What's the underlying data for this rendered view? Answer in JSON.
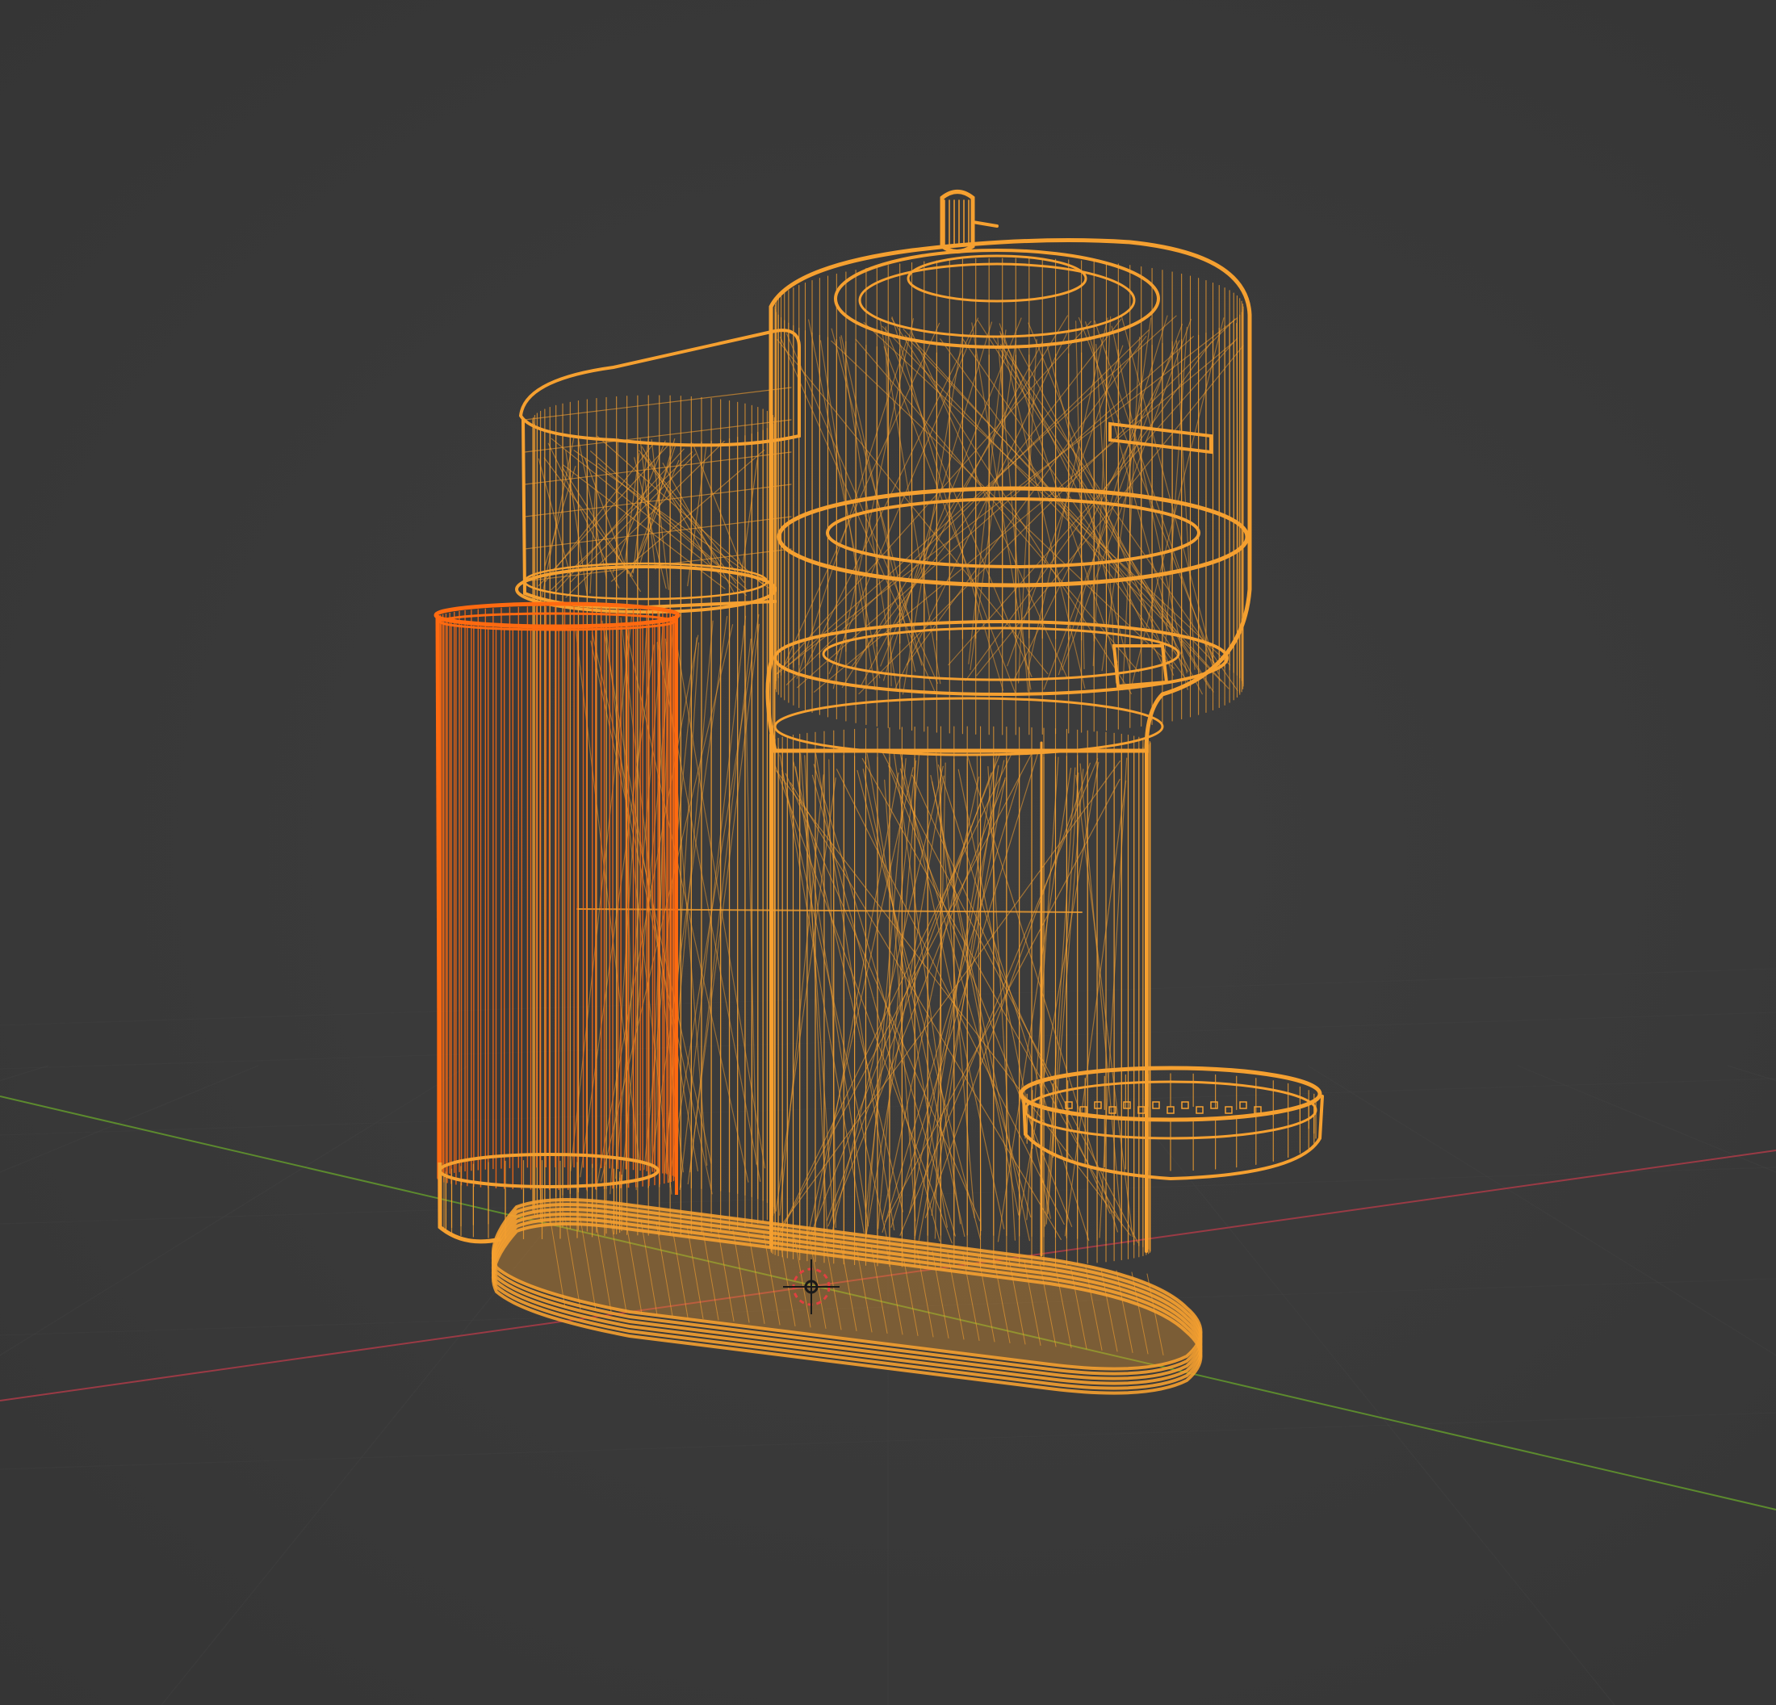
{
  "app": {
    "view": "3D Viewport",
    "shading": "wireframe"
  },
  "colors": {
    "background": "#3a3a3a",
    "grid": "#454545",
    "axis_x": "#9a3a45",
    "axis_y": "#5c8a2e",
    "wire_selected": "#f5a030",
    "wire_active": "#ff6a10",
    "cursor": "#e04040"
  },
  "scene": {
    "object": "coffee-machine",
    "active_object": "water-tank",
    "cursor_icon": "3d-cursor-icon"
  }
}
